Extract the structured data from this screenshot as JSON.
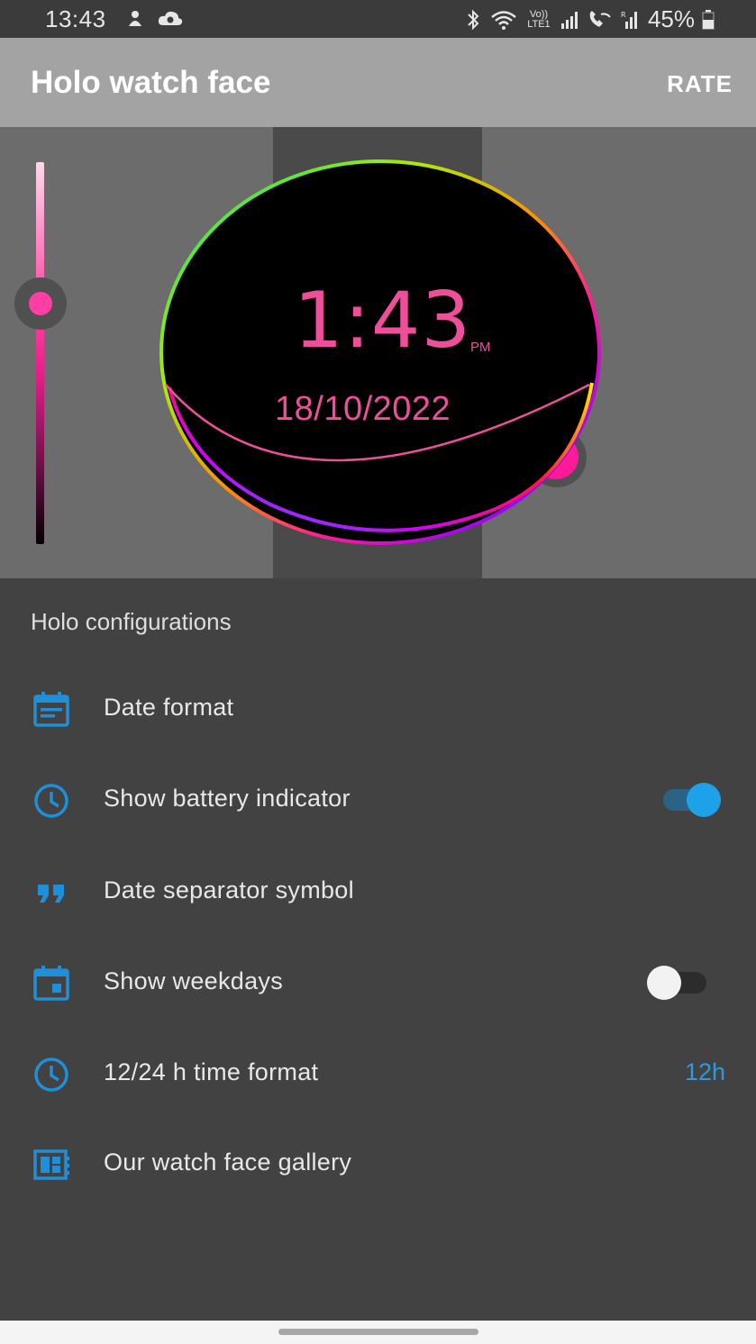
{
  "status_bar": {
    "time": "13:43",
    "left_icons": [
      "android-debug-icon",
      "cloud-sync-icon"
    ],
    "right_icons": [
      "bluetooth-icon",
      "wifi-icon",
      "volte-icon",
      "signal-icon",
      "wifi-calling-icon",
      "roaming-signal-icon"
    ],
    "volte_label": "Vo)) LTE1",
    "battery": "45%"
  },
  "app_bar": {
    "title": "Holo watch face",
    "rate_label": "RATE"
  },
  "preview": {
    "time": "1:43",
    "ampm": "PM",
    "date": "18/10/2022",
    "accent_color": "#ef4e9a",
    "slider_level": 0.37
  },
  "settings": {
    "section_title": "Holo configurations",
    "items": [
      {
        "label": "Date format",
        "icon": "calendar-icon"
      },
      {
        "label": "Show battery indicator",
        "icon": "clock-icon",
        "toggle": true
      },
      {
        "label": "Date separator symbol",
        "icon": "quote-icon"
      },
      {
        "label": "Show weekdays",
        "icon": "calendar-event-icon",
        "toggle": false
      },
      {
        "label": "12/24 h time format",
        "icon": "clock-icon",
        "value": "12h"
      },
      {
        "label": "Our watch face gallery",
        "icon": "gallery-icon"
      }
    ]
  },
  "colors": {
    "icon_blue": "#1e8fd8",
    "toggle_on": "#1da2ea",
    "background": "#424242"
  }
}
